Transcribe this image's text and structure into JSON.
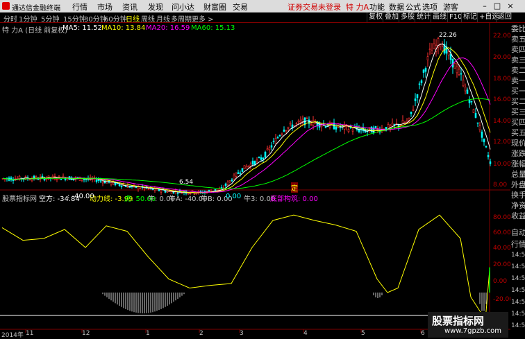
{
  "titlebar": {
    "app_title": "通达信金融终端",
    "menu": [
      "行情",
      "市场",
      "资讯",
      "发现",
      "问小达",
      "财富圈",
      "交易"
    ],
    "alert": "证券交易未登录",
    "stock": "特 力A",
    "right_menu": [
      "功能",
      "数据",
      "公式",
      "选项",
      "游客"
    ],
    "min": "–",
    "max": "□",
    "close": "×"
  },
  "toolbar": {
    "periods": [
      "分时",
      "1分钟",
      "5分钟",
      "15分钟",
      "30分钟",
      "60分钟",
      "日线",
      "周线",
      "月线",
      "多周期",
      "更多 >"
    ],
    "active_period": "日线",
    "right_buttons": [
      "复权",
      "叠加",
      "多股",
      "统计",
      "画线",
      "F10",
      "标记",
      "+自选",
      "返回"
    ]
  },
  "ma_header": {
    "stock_label": "特 力A (日线 前复权)",
    "ma5": "MA5: 11.52",
    "ma10": "MA10: 13.84",
    "ma20": "MA20: 16.59",
    "ma60": "MA60: 15.13",
    "colors": {
      "ma5": "#ffffff",
      "ma10": "#ffff00",
      "ma20": "#ff00ff",
      "ma60": "#00ff00"
    }
  },
  "price_axis": [
    "22.00",
    "20.00",
    "18.00",
    "16.00",
    "14.00",
    "12.00",
    "10.00",
    "8.00"
  ],
  "annotations": {
    "high": "22.26",
    "low": "6.54",
    "marker": "定"
  },
  "right_panel": [
    "委比",
    "卖五",
    "卖四",
    "卖三",
    "卖二",
    "卖一",
    "买一",
    "买二",
    "买三",
    "买四",
    "买五",
    "现价",
    "涨跌",
    "涨幅",
    "总量",
    "外盘",
    "换手",
    "净资",
    "收益",
    "自动",
    "行情",
    "14:50",
    "14:50",
    "14:50",
    "14:50",
    "14:50",
    "14:50",
    "14:50",
    "14:50",
    "14:50",
    "14:50"
  ],
  "indicator_header": {
    "name": "股票指标网",
    "kong": "空方: -34.84",
    "v1": ": -40.00",
    "dongli": "动力线: -3.99",
    "hu": "虎: 50.00",
    "niu": "牛: 0.00",
    "niuA": "牛A: -40.00",
    "niuB": "牛B: 0.00",
    "v2": "0.00",
    "niu3": "牛3: 0.00",
    "dibu": "底部构筑: 0.00"
  },
  "indicator_axis": [
    "80.00",
    "60.00",
    "40.00",
    "20.00",
    "0.00",
    "-20.00"
  ],
  "date_axis": [
    "2014年",
    "11",
    "12",
    "1",
    "2",
    "3",
    "4",
    "5",
    "6"
  ],
  "watermark": {
    "line1": "股票指标网",
    "line2": "www.7gpzb.com"
  },
  "colors": {
    "up": "#ff3030",
    "down": "#00ffff",
    "axis": "#800000",
    "ma5": "#ffffff",
    "ma10": "#ffff00",
    "ma20": "#ff00ff",
    "ma60": "#00ff00"
  }
}
